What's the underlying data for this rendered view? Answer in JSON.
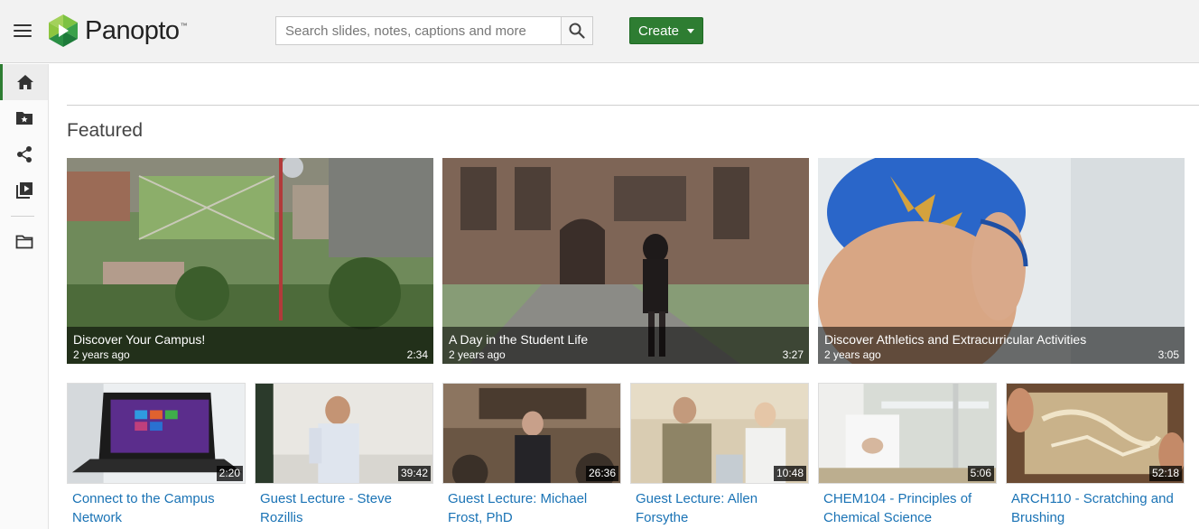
{
  "header": {
    "logo_text": "Panopto",
    "logo_tm": "™",
    "search_placeholder": "Search slides, notes, captions and more",
    "create_label": "Create"
  },
  "sidebar": {
    "items": [
      {
        "name": "home-icon",
        "active": true
      },
      {
        "name": "starred-folder-icon",
        "active": false
      },
      {
        "name": "share-icon",
        "active": false
      },
      {
        "name": "playlist-icon",
        "active": false
      },
      {
        "name": "folder-icon",
        "active": false
      }
    ]
  },
  "featured": {
    "heading": "Featured",
    "large": [
      {
        "title": "Discover Your Campus!",
        "date": "2 years ago",
        "duration": "2:34"
      },
      {
        "title": "A Day in the Student Life",
        "date": "2 years ago",
        "duration": "3:27"
      },
      {
        "title": "Discover Athletics and Extracurricular Activities",
        "date": "2 years ago",
        "duration": "3:05"
      }
    ],
    "small": [
      {
        "title_line1": "Connect to the Campus",
        "title_line2": "Network",
        "duration": "2:20"
      },
      {
        "title_line1": "Guest Lecture - Steve",
        "title_line2": "Rozillis",
        "duration": "39:42"
      },
      {
        "title_line1": "Guest Lecture: Michael",
        "title_line2": "Frost, PhD",
        "duration": "26:36"
      },
      {
        "title_line1": "Guest Lecture: Allen",
        "title_line2": "Forsythe",
        "duration": "10:48"
      },
      {
        "title_line1": "CHEM104 - Principles of",
        "title_line2": "Chemical Science",
        "duration": "5:06"
      },
      {
        "title_line1": "ARCH110 - Scratching and",
        "title_line2": "Brushing",
        "duration": "52:18"
      }
    ]
  },
  "colors": {
    "brand_green": "#2e7d32",
    "link_blue": "#1a73b5",
    "header_bg": "#f2f2f2"
  }
}
